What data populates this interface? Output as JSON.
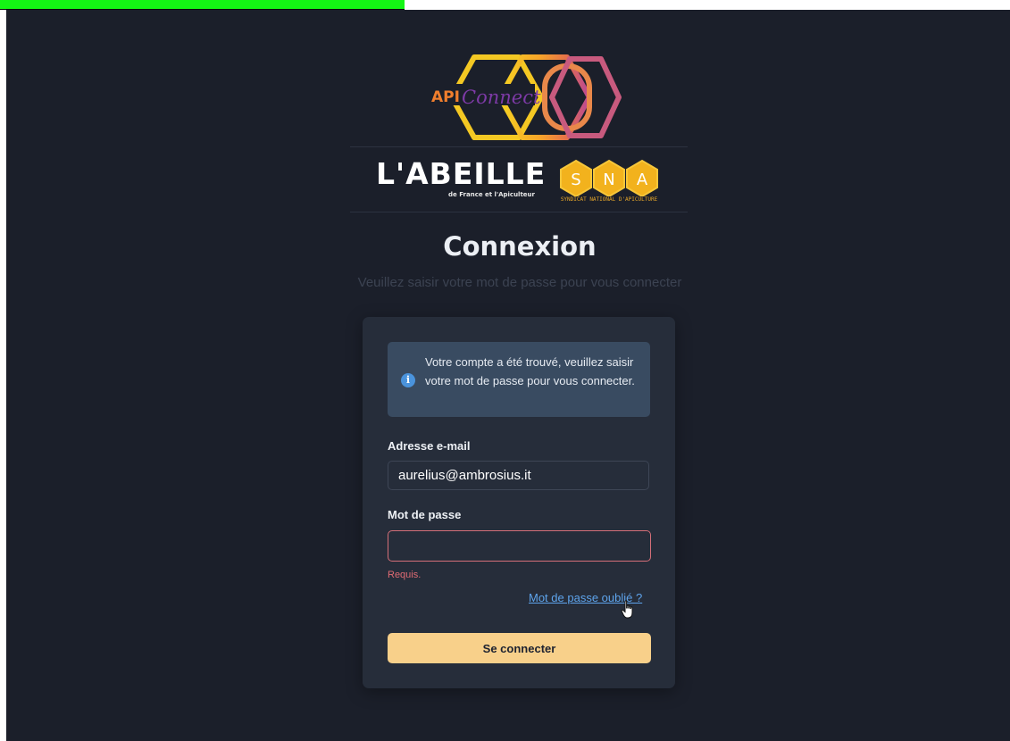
{
  "brand": {
    "api_logo_text_api": "API",
    "api_logo_text_connect": "Connect",
    "abeille_title": "L'ABEILLE",
    "abeille_subtitle": "de France et l'Apiculteur",
    "sna_letters": [
      "S",
      "N",
      "A"
    ],
    "sna_caption": "SYNDICAT NATIONAL D'APICULTURE"
  },
  "header": {
    "title": "Connexion",
    "subtitle": "Veuillez saisir votre mot de passe pour vous connecter"
  },
  "card": {
    "info_message": "Votre compte a été trouvé, veuillez saisir votre mot de passe pour vous connecter.",
    "info_icon_glyph": "i",
    "email_label": "Adresse e-mail",
    "email_value": "aurelius@ambrosius.it",
    "password_label": "Mot de passe",
    "password_value": "",
    "error_text": "Requis.",
    "forgot_link": "Mot de passe oublié ?",
    "submit_label": "Se connecter"
  },
  "colors": {
    "page_bg": "#1b1f2a",
    "card_bg": "#262d3a",
    "info_bg": "#394b61",
    "accent_button": "#f8d08a",
    "error": "#e06b73",
    "link": "#5ea4ec",
    "top_strip": "#14f514"
  },
  "icons": {
    "info": "info-circle-icon",
    "cursor": "hand-pointer-icon"
  }
}
